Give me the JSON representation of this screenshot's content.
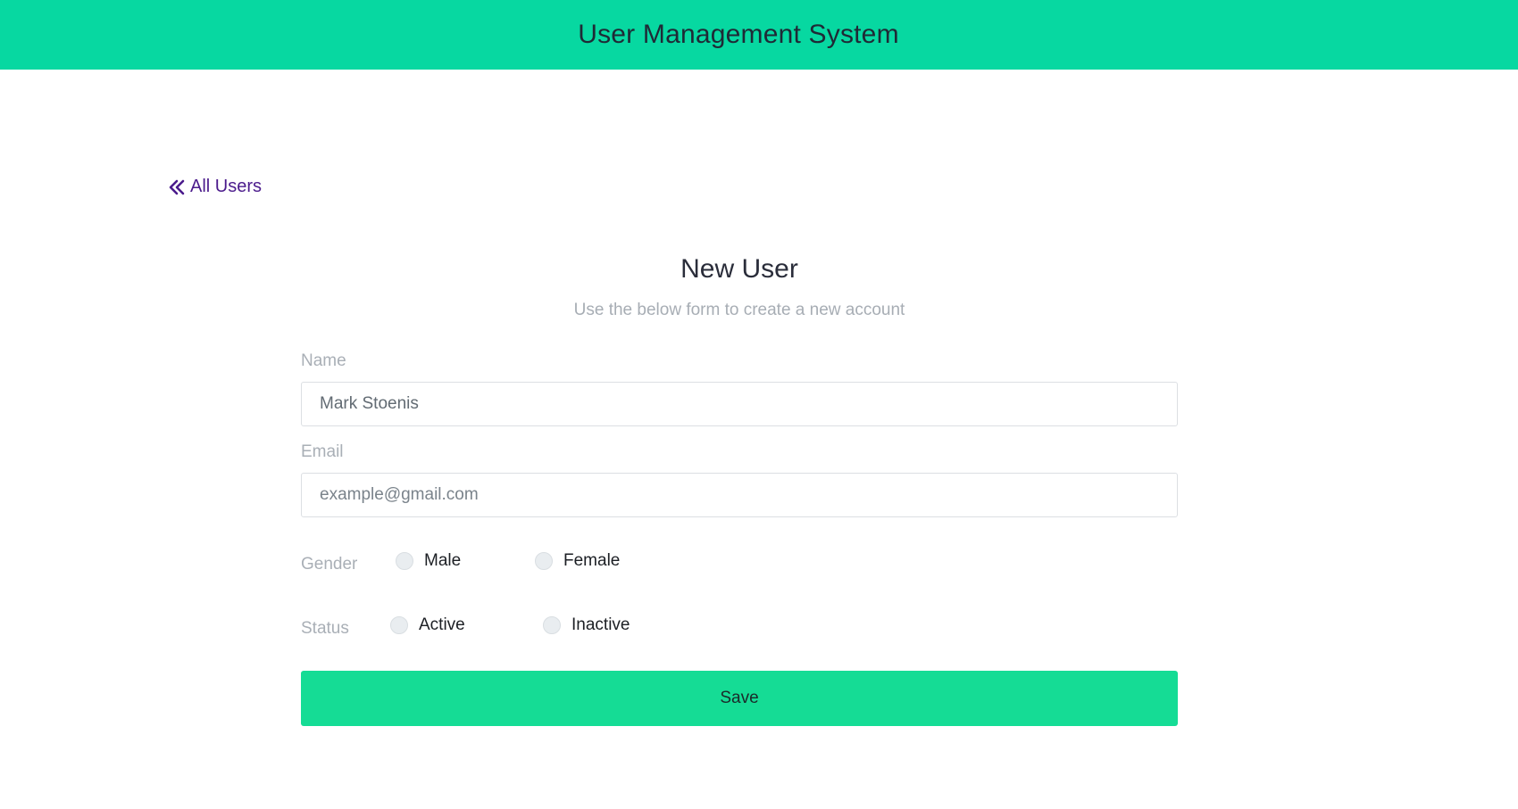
{
  "header": {
    "title": "User Management System",
    "bg_color": "#07d8a1"
  },
  "back_link": {
    "label": "All Users",
    "icon": "double-chevron-left-icon",
    "color": "#4b1b8c"
  },
  "form": {
    "title": "New User",
    "subtitle": "Use the below form to create a new account",
    "name": {
      "label": "Name",
      "value": "Mark Stoenis",
      "placeholder": ""
    },
    "email": {
      "label": "Email",
      "value": "",
      "placeholder": "example@gmail.com"
    },
    "gender": {
      "label": "Gender",
      "options": [
        "Male",
        "Female"
      ]
    },
    "status": {
      "label": "Status",
      "options": [
        "Active",
        "Inactive"
      ]
    },
    "save_label": "Save",
    "save_color": "#15dc95"
  }
}
